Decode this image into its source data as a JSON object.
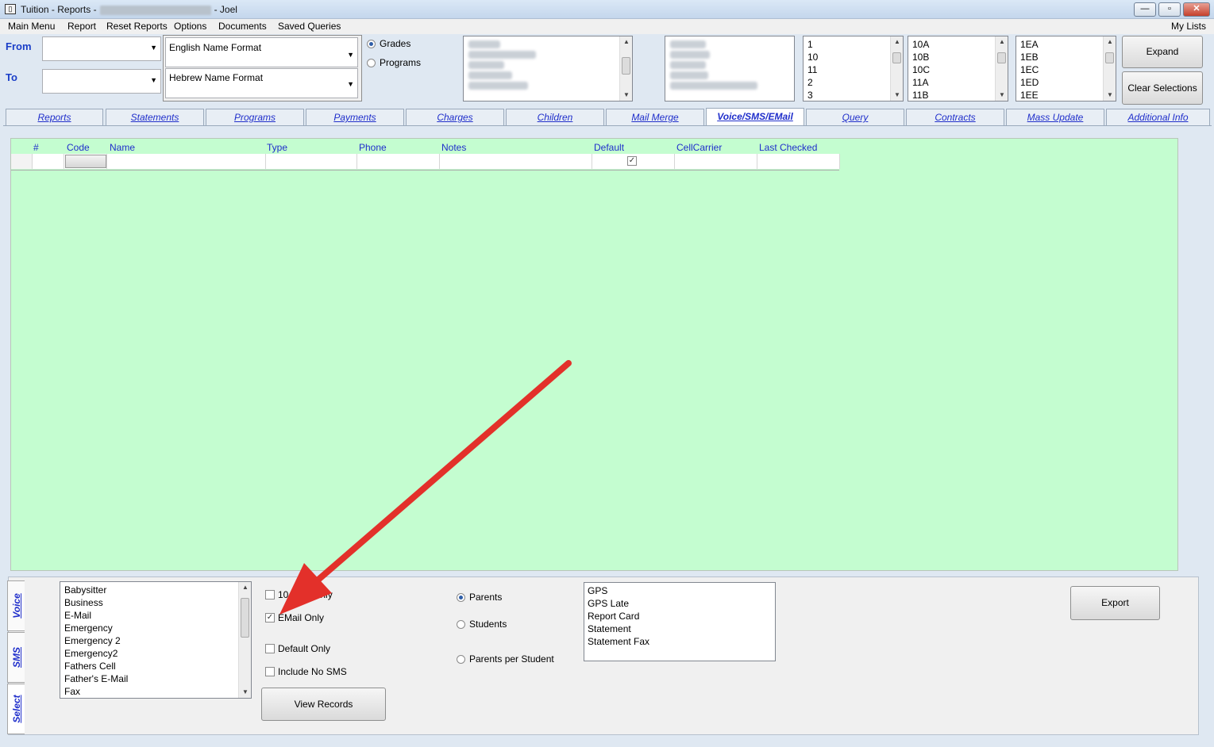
{
  "window": {
    "title_prefix": "Tuition - Reports -",
    "title_user": "- Joel",
    "controls": {
      "minimize": "—",
      "maximize": "▫",
      "close": "✕"
    }
  },
  "menubar": {
    "items": [
      "Main Menu",
      "Report",
      "Reset Reports",
      "Options",
      "Documents",
      "Saved Queries"
    ],
    "right": "My Lists"
  },
  "filters": {
    "from_label": "From",
    "to_label": "To",
    "english_format": "English Name Format",
    "hebrew_format": "Hebrew Name Format",
    "radio_grades": "Grades",
    "radio_programs": "Programs",
    "selected_radio": "Grades",
    "list_grades": [
      "1",
      "10",
      "11",
      "2",
      "3"
    ],
    "list_classes": [
      "10A",
      "10B",
      "10C",
      "11A",
      "11B"
    ],
    "list_sections": [
      "1EA",
      "1EB",
      "1EC",
      "1ED",
      "1EE"
    ]
  },
  "buttons": {
    "expand": "Expand",
    "clear_selections": "Clear Selections",
    "view_records": "View Records",
    "export": "Export"
  },
  "tabs": [
    "Reports",
    "Statements",
    "Programs",
    "Payments",
    "Charges",
    "Children",
    "Mail Merge",
    "Voice/SMS/EMail",
    "Query",
    "Contracts",
    "Mass Update",
    "Additional Info"
  ],
  "active_tab": "Voice/SMS/EMail",
  "grid": {
    "columns": [
      "#",
      "Code",
      "Name",
      "Type",
      "Phone",
      "Notes",
      "Default",
      "CellCarrier",
      "Last Checked"
    ],
    "new_row_default_checked": true
  },
  "bottom": {
    "vertical_tabs": [
      "Voice",
      "SMS",
      "Select"
    ],
    "phone_types": [
      "Babysitter",
      "Business",
      "E-Mail",
      "Emergency",
      "Emergency 2",
      "Emergency2",
      "Fathers Cell",
      "Father's E-Mail",
      "Fax"
    ],
    "checkboxes": [
      {
        "label": "10 Digit Only",
        "checked": false
      },
      {
        "label": "EMail Only",
        "checked": true
      },
      {
        "label": "Default Only",
        "checked": false
      },
      {
        "label": "Include No SMS",
        "checked": false
      }
    ],
    "radios": [
      "Parents",
      "Students",
      "Parents per Student"
    ],
    "selected_radio": "Parents",
    "report_list": [
      "GPS",
      "GPS Late",
      "Report Card",
      "Statement",
      "Statement Fax"
    ]
  },
  "colors": {
    "grid_bg": "#c4fdd0",
    "link_blue": "#1f2ecb",
    "arrow_red": "#e3302a"
  }
}
